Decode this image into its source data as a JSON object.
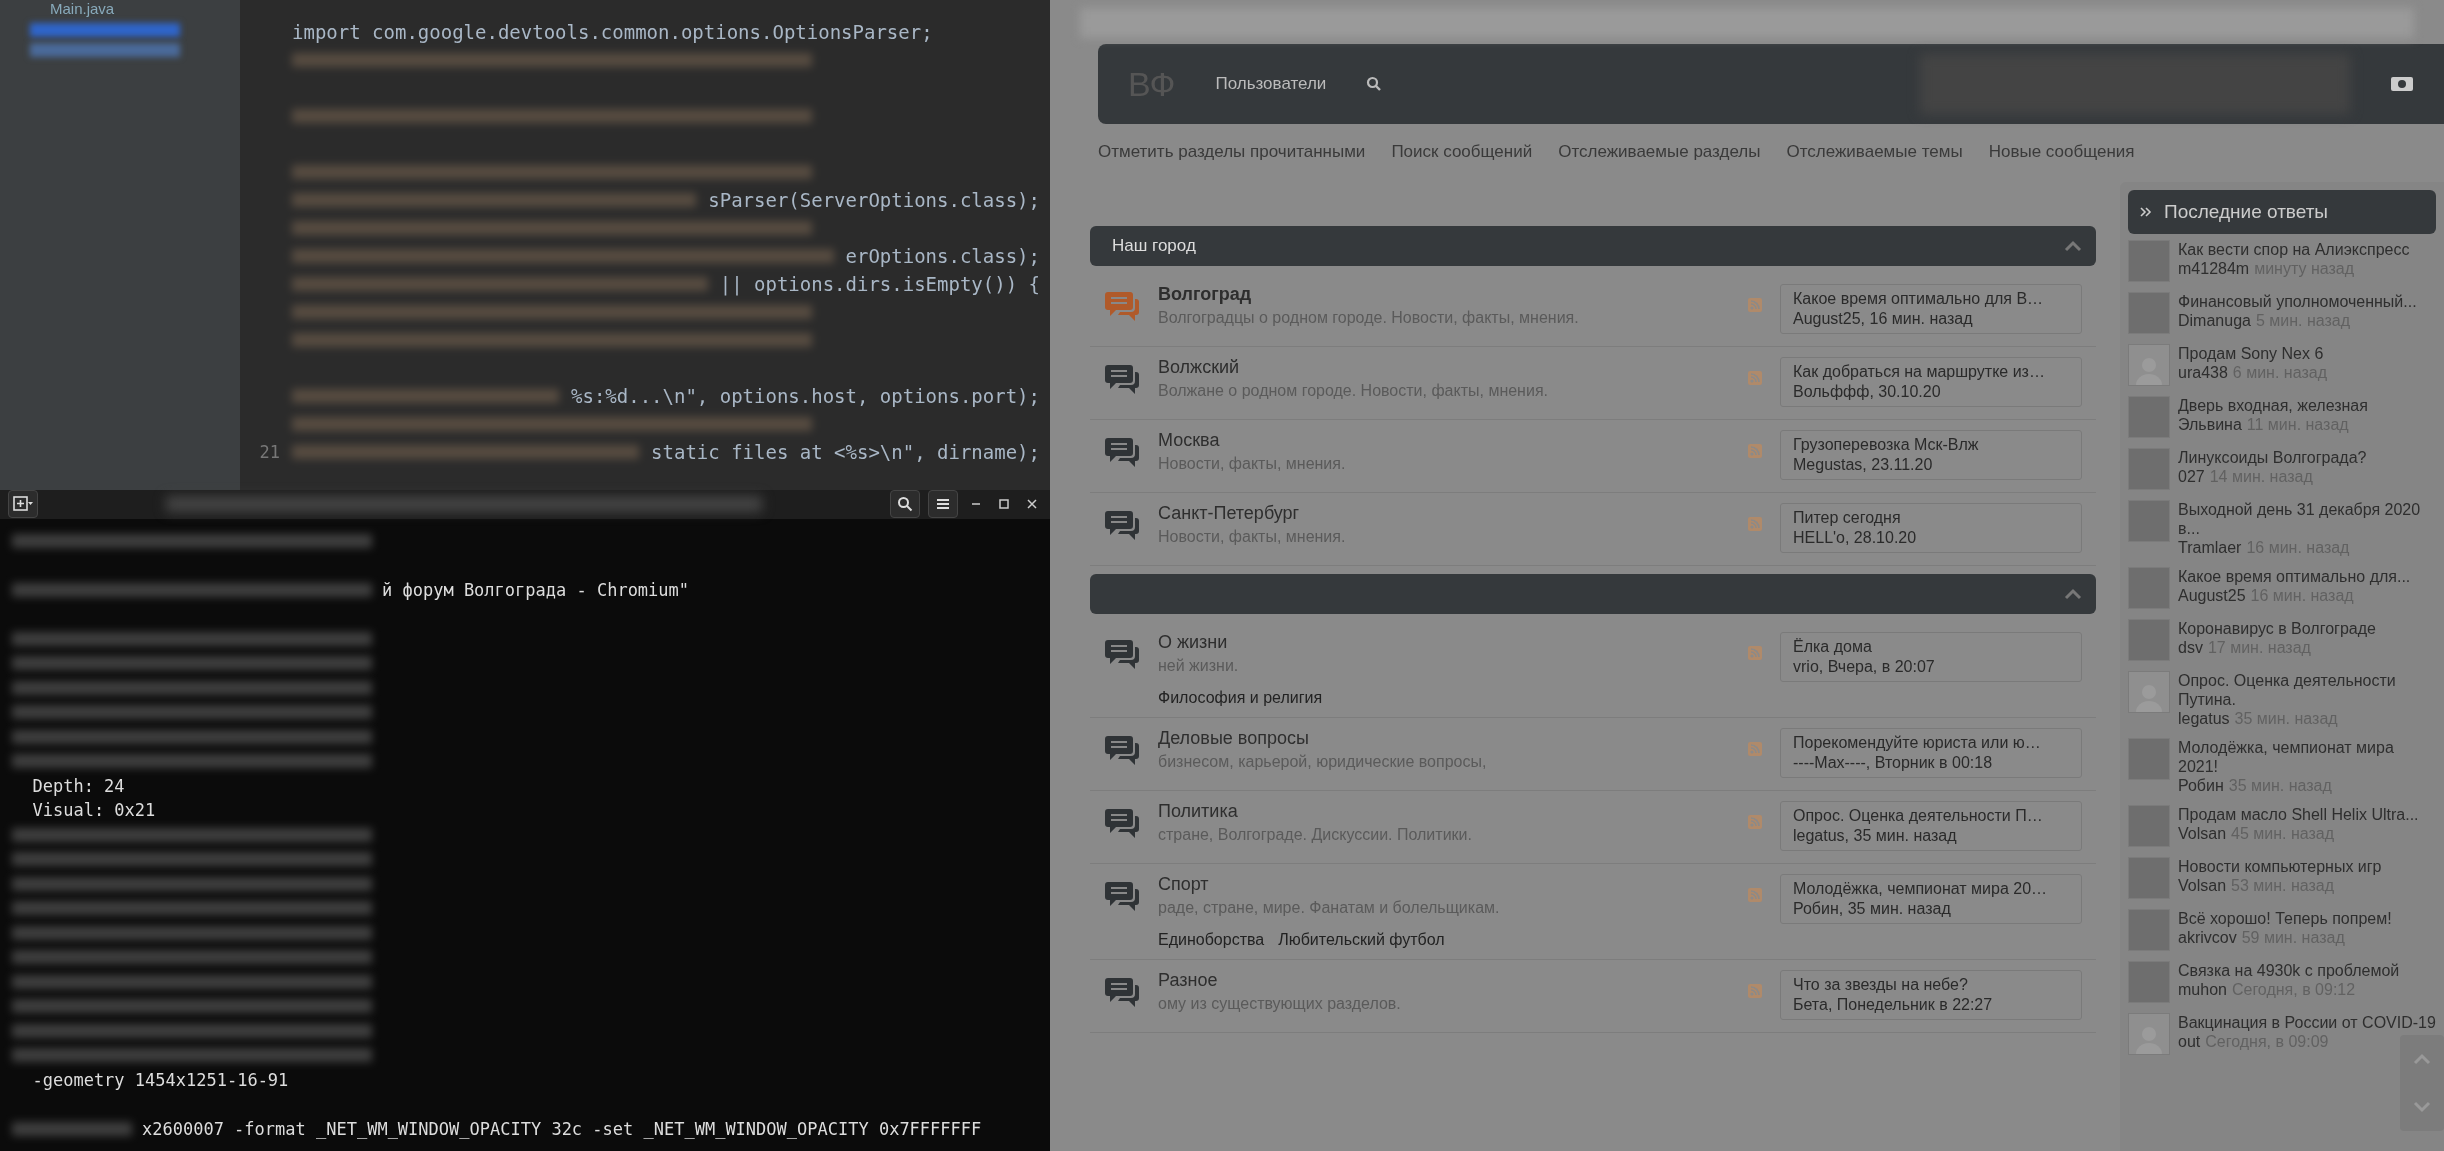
{
  "editor": {
    "files": [
      "Main.java"
    ],
    "code_lines": [
      {
        "kind": "plain",
        "text": "import com.google.devtools.common.options.OptionsParser;"
      },
      {
        "kind": "blurred"
      },
      {
        "kind": "blank"
      },
      {
        "kind": "blurred"
      },
      {
        "kind": "blank"
      },
      {
        "kind": "blurred"
      },
      {
        "kind": "partial",
        "text": "sParser(ServerOptions.class);"
      },
      {
        "kind": "blurred"
      },
      {
        "kind": "partial",
        "text": "erOptions.class);"
      },
      {
        "kind": "partial",
        "text": "|| options.dirs.isEmpty()) {"
      },
      {
        "kind": "blurred"
      },
      {
        "kind": "blurred"
      },
      {
        "kind": "blank"
      },
      {
        "kind": "partial",
        "text": "%s:%d...\\n\", options.host, options.port);"
      },
      {
        "kind": "blurred"
      },
      {
        "kind": "partial",
        "text": "static files at <%s>\\n\", dirname);",
        "line_number": "21"
      }
    ]
  },
  "terminal": {
    "lines": [
      {
        "kind": "blurred"
      },
      {
        "kind": "blank"
      },
      {
        "kind": "partial",
        "text": "й форум Волгограда - Chromium\""
      },
      {
        "kind": "blank"
      },
      {
        "kind": "blurred"
      },
      {
        "kind": "blurred"
      },
      {
        "kind": "blurred"
      },
      {
        "kind": "blurred"
      },
      {
        "kind": "blurred"
      },
      {
        "kind": "blurred"
      },
      {
        "kind": "plain",
        "text": "  Depth: 24"
      },
      {
        "kind": "plain",
        "text": "  Visual: 0x21"
      },
      {
        "kind": "blurred"
      },
      {
        "kind": "blurred"
      },
      {
        "kind": "blurred"
      },
      {
        "kind": "blurred"
      },
      {
        "kind": "blurred"
      },
      {
        "kind": "blurred"
      },
      {
        "kind": "blurred"
      },
      {
        "kind": "blurred"
      },
      {
        "kind": "blurred"
      },
      {
        "kind": "blurred"
      },
      {
        "kind": "plain",
        "text": "  -geometry 1454x1251-16-91"
      },
      {
        "kind": "blank"
      },
      {
        "kind": "partial",
        "text": "x2600007 -format _NET_WM_WINDOW_OPACITY 32c -set _NET_WM_WINDOW_OPACITY 0x7FFFFFFF"
      }
    ]
  },
  "forum": {
    "logo": "ВФ",
    "menu": [
      "Пользователи"
    ],
    "nav": [
      "Отметить разделы прочитанными",
      "Поиск сообщений",
      "Отслеживаемые разделы",
      "Отслеживаемые темы",
      "Новые сообщения"
    ],
    "sections": [
      {
        "title": "Наш город",
        "forums": [
          {
            "title": "Волгоград",
            "unread": true,
            "description": "Волгоградцы о родном городе. Новости, факты, мнения.",
            "last_title": "Какое время оптимально для В…",
            "last_meta": "August25, 16 мин. назад"
          },
          {
            "title": "Волжский",
            "unread": false,
            "description": "Волжане о родном городе. Новости, факты, мнения.",
            "last_title": "Как добраться на маршрутке из…",
            "last_meta": "Вольффф, 30.10.20"
          },
          {
            "title": "Москва",
            "unread": false,
            "description": "Новости, факты, мнения.",
            "last_title": "Грузоперевозка Мск-Влж",
            "last_meta": "Megustas, 23.11.20"
          },
          {
            "title": "Санкт-Петербург",
            "unread": false,
            "description": "Новости, факты, мнения.",
            "last_title": "Питер сегодня",
            "last_meta": "HELL'o, 28.10.20"
          }
        ]
      },
      {
        "forums": [
          {
            "title": "О жизни",
            "unread": false,
            "description": "ней жизни.",
            "subforums": [
              "Философия и религия"
            ],
            "last_title": "Ёлка дома",
            "last_meta": "vrio, Вчера, в 20:07"
          },
          {
            "title": "Деловые вопросы",
            "unread": false,
            "description": "бизнесом, карьерой, юридические вопросы,",
            "last_title": "Порекомендуйте юриста или ю…",
            "last_meta": "----Max----, Вторник в 00:18"
          },
          {
            "title": "Политика",
            "unread": false,
            "description": "стране, Волгограде. Дискуссии. Политики.",
            "last_title": "Опрос. Оценка деятельности П…",
            "last_meta": "legatus, 35 мин. назад"
          },
          {
            "title": "Спорт",
            "unread": false,
            "description": "раде, стране, мире. Фанатам и болельщикам.",
            "subforums": [
              "Единоборства",
              "Любительский футбол"
            ],
            "last_title": "Молодёжка, чемпионат мира 20…",
            "last_meta": "Робин, 35 мин. назад"
          },
          {
            "title": "Разное",
            "unread": false,
            "description": "ому из существующих разделов.",
            "last_title": "Что за звезды на небе?",
            "last_meta": "Бета, Понедельник в 22:27"
          }
        ]
      }
    ],
    "sidebar": {
      "title": "Последние ответы",
      "items": [
        {
          "kind": "photo",
          "title": "Как вести спор на Алиэкспресс",
          "user": "m41284m",
          "time": "минуту назад"
        },
        {
          "kind": "photo",
          "title": "Финансовый уполномоченный...",
          "user": "Dimanuga",
          "time": "5 мин. назад"
        },
        {
          "kind": "default",
          "title": "Продам Sony Nex 6",
          "user": "ura438",
          "time": "6 мин. назад"
        },
        {
          "kind": "photo",
          "title": "Дверь входная, железная",
          "user": "Эльвина",
          "time": "11 мин. назад"
        },
        {
          "kind": "photo",
          "title": "Линуксоиды Волгограда?",
          "user": "027",
          "time": "14 мин. назад"
        },
        {
          "kind": "photo",
          "title": "Выходной день 31 декабря 2020 в...",
          "user": "Tramlaer",
          "time": "16 мин. назад"
        },
        {
          "kind": "photo",
          "title": "Какое время оптимально для...",
          "user": "August25",
          "time": "16 мин. назад"
        },
        {
          "kind": "photo",
          "title": "Коронавирус в Волгограде",
          "user": "dsv",
          "time": "17 мин. назад"
        },
        {
          "kind": "default",
          "title": "Опрос. Оценка деятельности Путина.",
          "user": "legatus",
          "time": "35 мин. назад"
        },
        {
          "kind": "photo",
          "title": "Молодёжка, чемпионат мира 2021!",
          "user": "Робин",
          "time": "35 мин. назад"
        },
        {
          "kind": "photo",
          "title": "Продам масло Shell Helix Ultra...",
          "user": "Volsan",
          "time": "45 мин. назад"
        },
        {
          "kind": "photo",
          "title": "Новости компьютерных игр",
          "user": "Volsan",
          "time": "53 мин. назад"
        },
        {
          "kind": "photo",
          "title": "Всё хорошо! Теперь попрем!",
          "user": "akrivcov",
          "time": "59 мин. назад"
        },
        {
          "kind": "photo",
          "title": "Связка на 4930k с проблемой",
          "user": "muhon",
          "time": "Сегодня, в 09:12"
        },
        {
          "kind": "default",
          "title": "Вакцинация в России от COVID-19",
          "user": "out",
          "time": "Сегодня, в 09:09"
        }
      ]
    }
  }
}
